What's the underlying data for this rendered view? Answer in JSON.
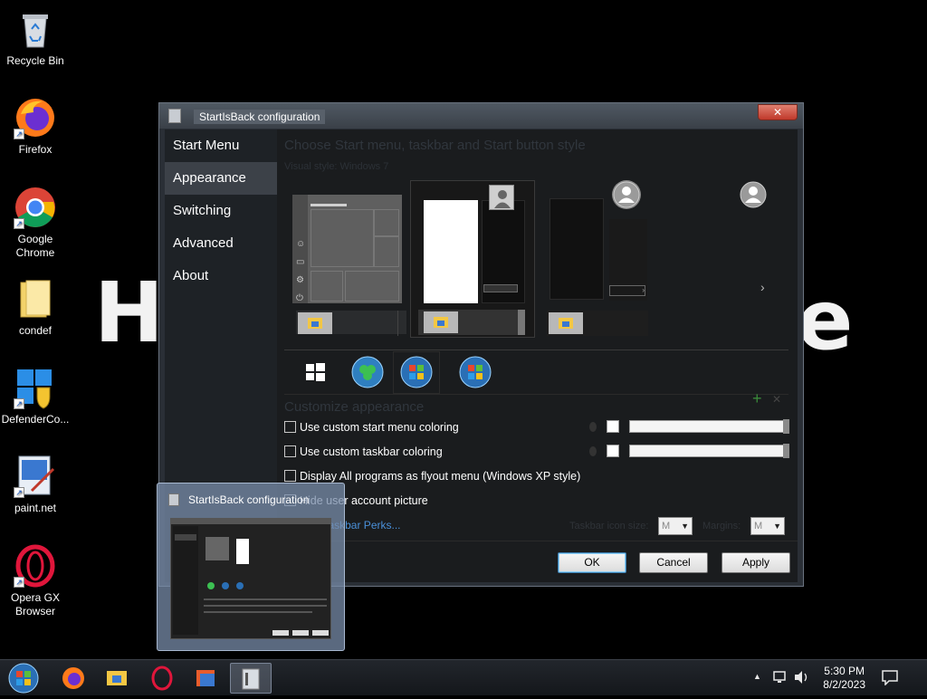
{
  "desktop": {
    "wallpaper_text_left": "H",
    "wallpaper_text_right": "e",
    "icons": [
      {
        "label": "Recycle Bin",
        "icon": "recycle-bin-icon"
      },
      {
        "label": "Firefox",
        "icon": "firefox-icon"
      },
      {
        "label": "Google Chrome",
        "icon": "chrome-icon"
      },
      {
        "label": "condef",
        "icon": "folder-icon"
      },
      {
        "label": "DefenderCo...",
        "icon": "defender-control-icon"
      },
      {
        "label": "paint.net",
        "icon": "paint-net-icon"
      },
      {
        "label": "Opera GX Browser",
        "icon": "opera-gx-icon"
      }
    ]
  },
  "window": {
    "title": "StartIsBack configuration",
    "close_label": "✕",
    "nav": [
      {
        "label": "Start Menu",
        "active": false
      },
      {
        "label": "Appearance",
        "active": true
      },
      {
        "label": "Switching",
        "active": false
      },
      {
        "label": "Advanced",
        "active": false
      },
      {
        "label": "About",
        "active": false
      }
    ],
    "content": {
      "heading": "Choose Start menu, taskbar and Start button style",
      "visual_style": "Visual style: Windows 7",
      "next_arrow": "›",
      "customize_heading": "Customize appearance",
      "plus": "+",
      "x_mark": "✕",
      "checkboxes": [
        {
          "label": "Use custom start menu coloring",
          "checked": false
        },
        {
          "label": "Use custom taskbar coloring",
          "checked": false
        },
        {
          "label": "Display All programs as flyout menu (Windows XP style)",
          "checked": false
        },
        {
          "label": "Hide user account picture",
          "checked": false
        }
      ],
      "perks_link": "Use Taskbar Perks...",
      "taskbar_icon_size_label": "Taskbar icon size:",
      "taskbar_icon_size_value": "M",
      "margins_label": "Margins:",
      "margins_value": "M"
    },
    "buttons": {
      "ok": "OK",
      "cancel": "Cancel",
      "apply": "Apply"
    }
  },
  "thumbnail": {
    "title": "StartIsBack configuration"
  },
  "taskbar": {
    "items": [
      "start-orb-icon",
      "firefox-icon",
      "file-explorer-icon",
      "opera-gx-icon",
      "app-stack-icon",
      "startisback-config-icon"
    ],
    "tray_chevron": "▲",
    "time": "5:30 PM",
    "date": "8/2/2023"
  },
  "colors": {
    "accent": "#3c4148",
    "close": "#c0392b",
    "link": "#4a90d9"
  }
}
